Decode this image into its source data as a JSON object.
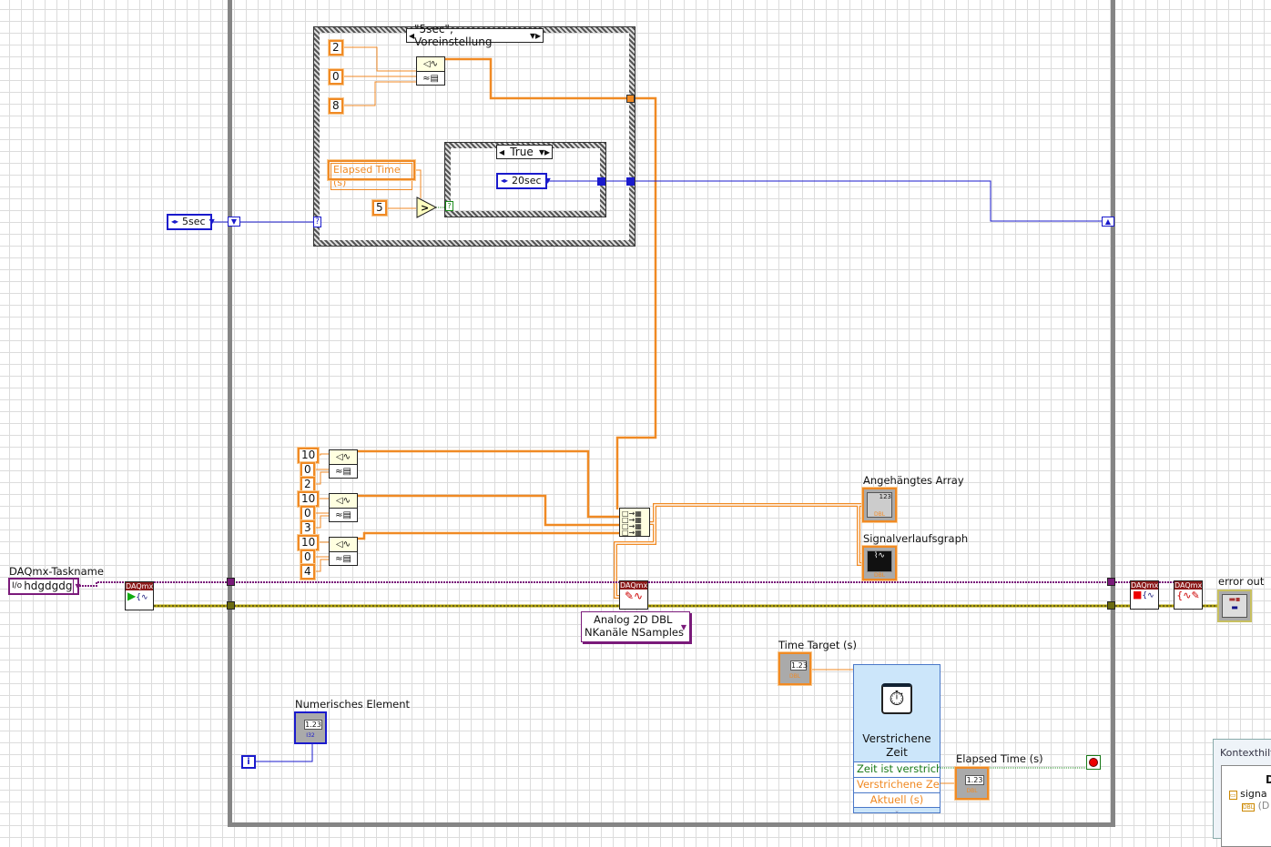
{
  "case_outer": {
    "selector": "\"5sec\", Voreinstellung"
  },
  "case_inner": {
    "selector": "True"
  },
  "constants": {
    "top": [
      "2",
      "0",
      "8"
    ],
    "compare_value": "5",
    "lower": [
      [
        "10",
        "0",
        "2"
      ],
      [
        "10",
        "0",
        "3"
      ],
      [
        "10",
        "0",
        "4"
      ]
    ]
  },
  "local_variable": "Elapsed Time (s)",
  "enums": {
    "inner": "20sec",
    "outer": "5sec"
  },
  "daqmx": {
    "task_label": "DAQmx-Taskname",
    "task_value": "hdgdgdg",
    "header": "DAQmx",
    "write_mode_line1": "Analog 2D DBL",
    "write_mode_line2": "NKanäle NSamples"
  },
  "indicators": {
    "appended_array": "Angehängtes Array",
    "waveform_graph": "Signalverlaufsgraph",
    "error_out": "error out",
    "numeric": "Numerisches Element",
    "elapsed": "Elapsed Time (s)",
    "numeric_display": "1.23",
    "dbl": "DBL",
    "i32": "I32",
    "array_display": "123"
  },
  "controls": {
    "time_target": "Time Target (s)"
  },
  "express_vi": {
    "title_line1": "Verstrichene",
    "title_line2": "Zeit",
    "outputs": [
      "Zeit ist verstrich",
      "Verstrichene Zei",
      "Aktuell (s)"
    ]
  },
  "iteration": "i",
  "context_help": {
    "title": "Kontexthilf",
    "heading": "D",
    "item": "signa",
    "sub": "(D"
  },
  "colors": {
    "orange_wire": "#f08a24",
    "blue_wire": "#1a1acc",
    "purple_wire": "#7a1a7a",
    "error_wire": "#c8c800",
    "loop_border": "#858585"
  }
}
